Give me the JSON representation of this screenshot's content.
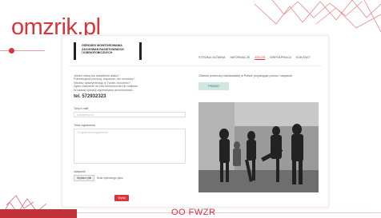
{
  "brand": "omzrik.pl",
  "site": {
    "logo_lines": [
      "OŚRODEK MONITOROWANIA",
      "ZACHOWAŃ RASISTOWSKICH",
      "I KSENOFOBICZNYCH"
    ],
    "nav": [
      "STRONA GŁÓWNA",
      "INFORMACJE",
      "ZGŁOŚ",
      "WSPÓŁPRACA",
      "KONTAKT"
    ],
    "nav_active": "ZGŁOŚ",
    "intro": [
      "Jesteś ofiarą lub świadkiem ataku?",
      "Potrzebujesz pomocy, wsparcia, lub rozmowy?",
      "Widzisz dyskryminację w Twoim otoczeniu?",
      "Zgłoś zdarzenie do nas telefonicznie lub mailowo.",
      "W każdej sytuacji zapewniamy anonimowość."
    ],
    "tel_label": "tel. 572932323",
    "form": {
      "email_label": "Twój e-mail",
      "email_placeholder": "twój@email.pl",
      "message_label": "Treść zgłoszenia",
      "message_placeholder": "Tu wpisz treść zgłoszenia",
      "attachment_label": "załącznik",
      "file_button": "Wybierz plik",
      "file_status": "Brak wybranego pliku",
      "submit": "Wyślij"
    },
    "notice": "Ofiarom przemocy rasistowskiej w Polsce przysługuje pomoc i wsparcie.",
    "prawo_button": "PRAWO"
  },
  "footer_logo": "OO FWZR",
  "colors": {
    "accent": "#d7353b",
    "prawo_bg": "#cfe6e1"
  }
}
